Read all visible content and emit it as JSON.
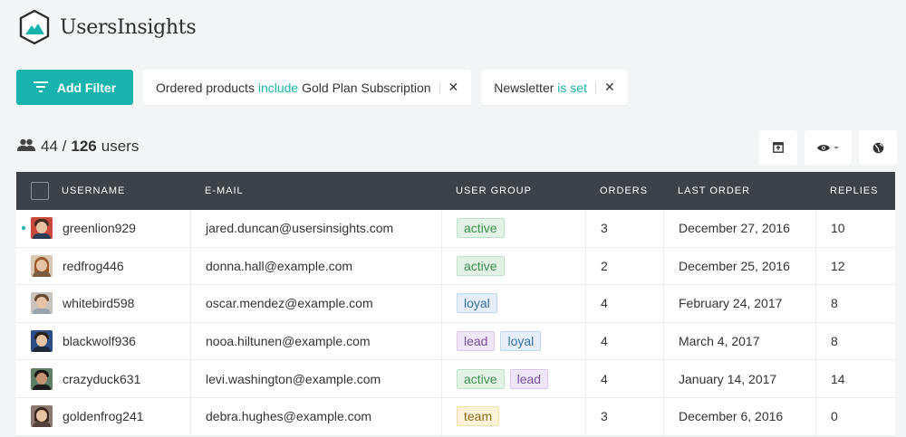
{
  "app": {
    "name": "UsersInsights",
    "accent": "#19b3ad"
  },
  "toolbar": {
    "add_filter_label": "Add Filter"
  },
  "filters": [
    {
      "prefix": "Ordered products",
      "operator": "include",
      "value": "Gold Plan Subscription",
      "remove_icon": "close-icon"
    },
    {
      "prefix": "Newsletter",
      "operator": "is set",
      "value": "",
      "remove_icon": "close-icon"
    }
  ],
  "summary": {
    "filtered": "44",
    "separator": "/",
    "total": "126",
    "unit": "users"
  },
  "actions": [
    {
      "name": "export-button",
      "icon": "export-icon"
    },
    {
      "name": "visibility-button",
      "icon": "eye-icon"
    },
    {
      "name": "map-button",
      "icon": "globe-icon"
    }
  ],
  "table": {
    "columns": [
      "USERNAME",
      "E-MAIL",
      "USER GROUP",
      "ORDERS",
      "LAST ORDER",
      "REPLIES"
    ],
    "rows": [
      {
        "username": "greenlion929",
        "email": "jared.duncan@usersinsights.com",
        "groups": [
          "active"
        ],
        "orders": "3",
        "last_order": "December 27, 2016",
        "replies": "10",
        "online": true
      },
      {
        "username": "redfrog446",
        "email": "donna.hall@example.com",
        "groups": [
          "active"
        ],
        "orders": "2",
        "last_order": "December 25, 2016",
        "replies": "12",
        "online": false
      },
      {
        "username": "whitebird598",
        "email": "oscar.mendez@example.com",
        "groups": [
          "loyal"
        ],
        "orders": "4",
        "last_order": "February 24, 2017",
        "replies": "8",
        "online": false
      },
      {
        "username": "blackwolf936",
        "email": "nooa.hiltunen@example.com",
        "groups": [
          "lead",
          "loyal"
        ],
        "orders": "4",
        "last_order": "March 4, 2017",
        "replies": "8",
        "online": false
      },
      {
        "username": "crazyduck631",
        "email": "levi.washington@example.com",
        "groups": [
          "active",
          "lead"
        ],
        "orders": "4",
        "last_order": "January 14, 2017",
        "replies": "14",
        "online": false
      },
      {
        "username": "goldenfrog241",
        "email": "debra.hughes@example.com",
        "groups": [
          "team"
        ],
        "orders": "3",
        "last_order": "December 6, 2016",
        "replies": "0",
        "online": false
      }
    ]
  }
}
